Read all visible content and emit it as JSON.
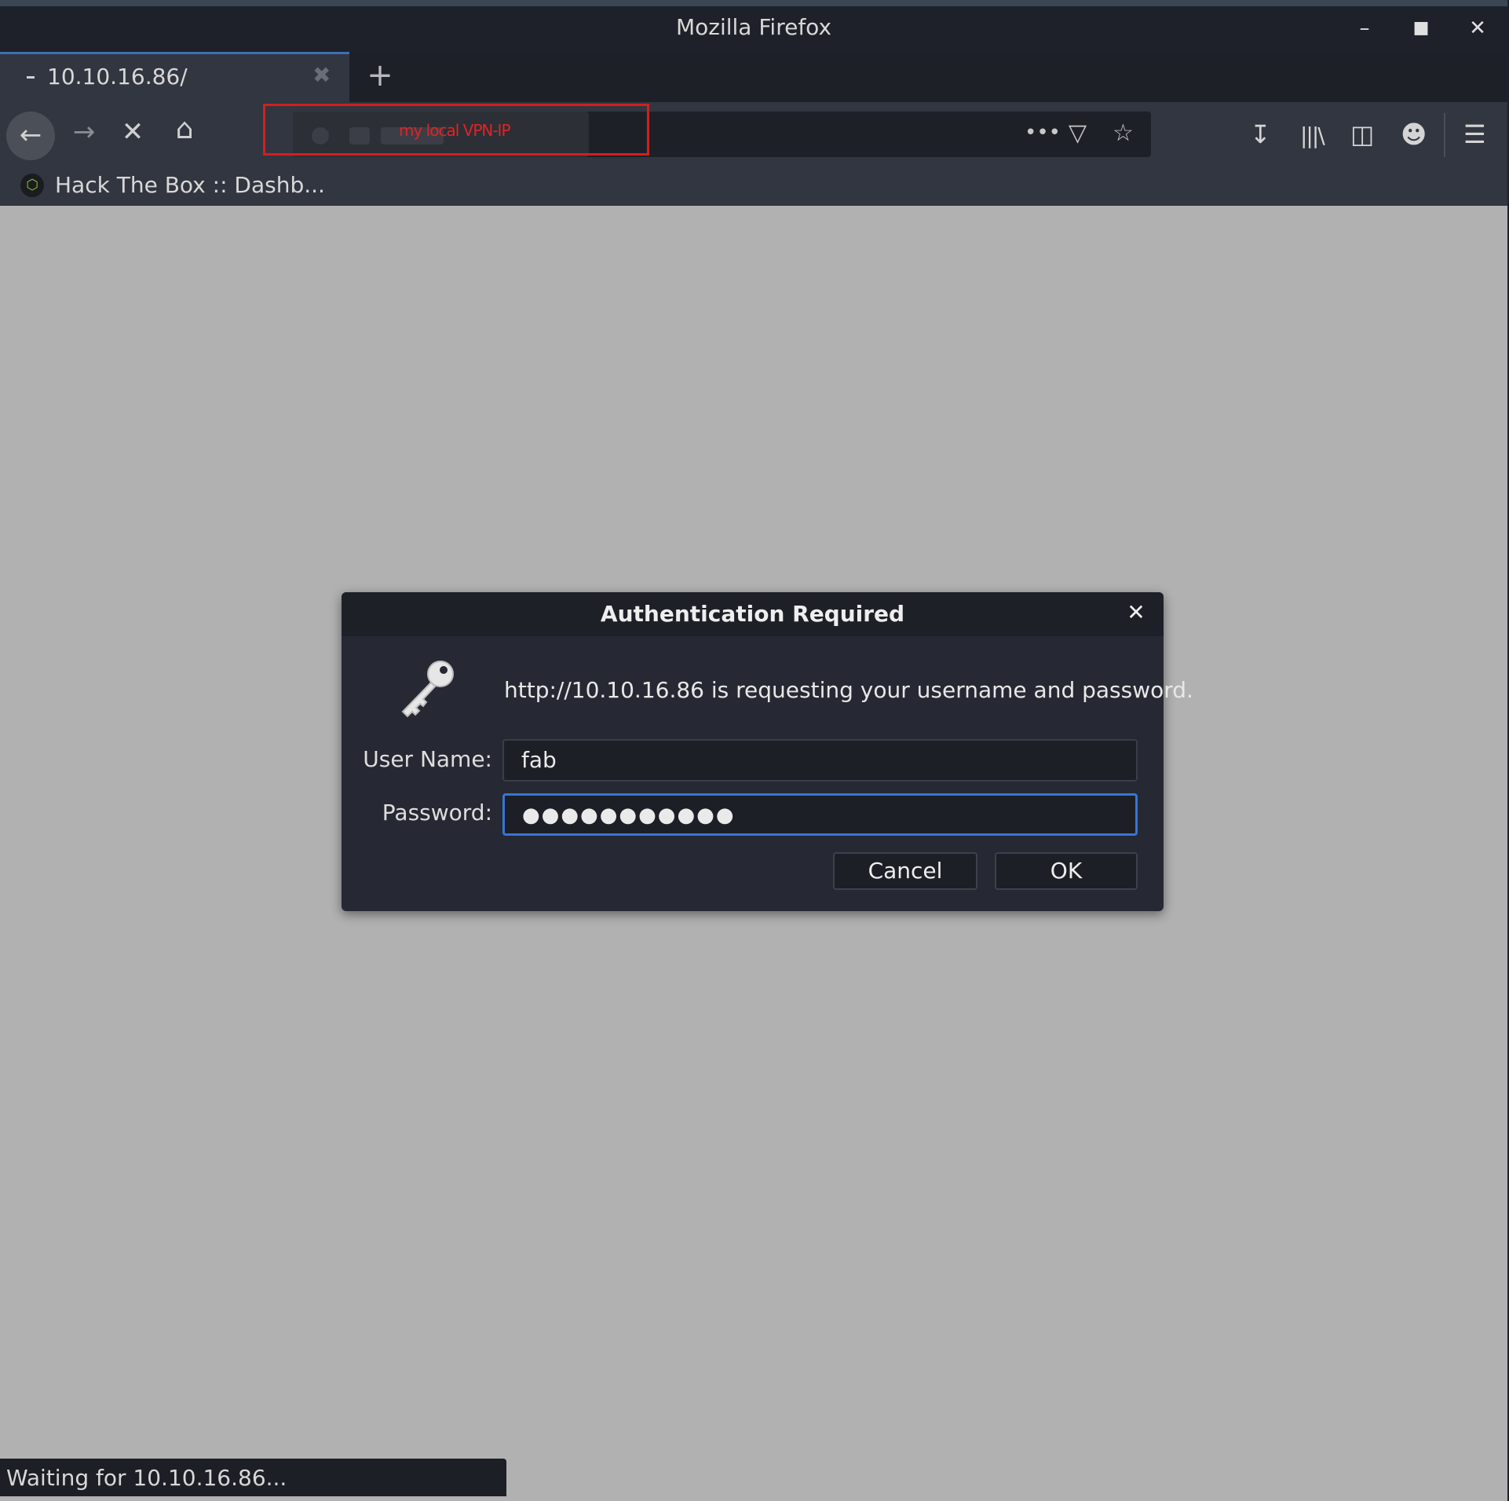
{
  "window": {
    "title": "Mozilla Firefox"
  },
  "tabs": [
    {
      "title": "10.10.16.86/"
    }
  ],
  "urlbar": {
    "annotation": "my local VPN-IP"
  },
  "bookmarks": [
    {
      "label": "Hack The Box :: Dashb..."
    }
  ],
  "dialog": {
    "title": "Authentication Required",
    "message": "http://10.10.16.86 is requesting your username and password.",
    "username_label": "User Name:",
    "username_value": "fab",
    "password_label": "Password:",
    "password_value": "●●●●●●●●●●●",
    "cancel_label": "Cancel",
    "ok_label": "OK"
  },
  "status": {
    "text": "Waiting for 10.10.16.86..."
  },
  "colors": {
    "page_bg": "#b1b1b1",
    "chrome_bg": "#323640",
    "focus_ring": "#3874d8",
    "annotation": "#d21f1f"
  }
}
